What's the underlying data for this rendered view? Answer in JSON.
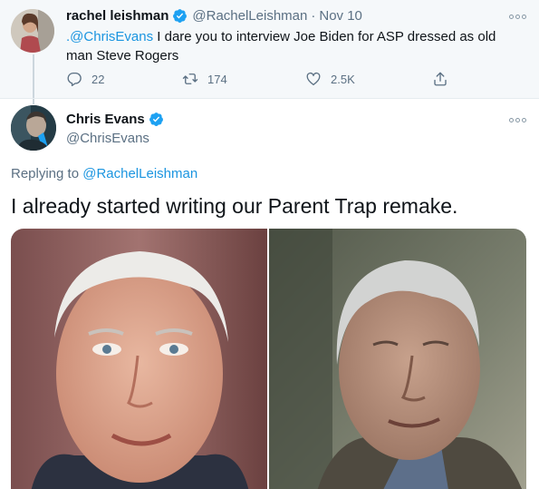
{
  "parent_tweet": {
    "display_name": "rachel leishman",
    "handle": "@RachelLeishman",
    "separator": "·",
    "date": "Nov 10",
    "mention": ".@ChrisEvans",
    "text_line1": " I dare you to interview Joe Biden for ASP dressed as old",
    "text_line2": "man Steve Rogers",
    "replies": "22",
    "retweets": "174",
    "likes": "2.5K"
  },
  "main_tweet": {
    "display_name": "Chris Evans",
    "handle": "@ChrisEvans",
    "replying_prefix": "Replying to ",
    "replying_to": "@RachelLeishman",
    "text": "I already started writing our Parent Trap remake."
  },
  "colors": {
    "link": "#1b95e0",
    "verified": "#1da1f2",
    "secondary_text": "#5b7083",
    "parent_background": "#f5f8fa"
  },
  "icons": [
    "verified-badge-icon",
    "more-options-icon",
    "reply-icon",
    "retweet-icon",
    "like-icon",
    "share-icon"
  ]
}
